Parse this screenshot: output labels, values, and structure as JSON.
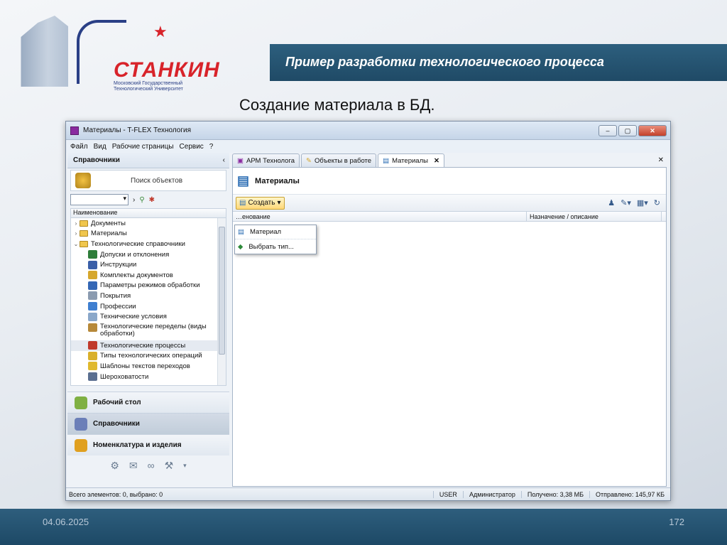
{
  "slide": {
    "banner_title": "Пример разработки технологического процесса",
    "subtitle": "Создание материала в БД.",
    "logo_name": "СТАНКИН",
    "logo_sub": "Московский Государственный Технологический Университет",
    "date": "04.06.2025",
    "page_number": "172"
  },
  "window": {
    "title": "Материалы - T-FLEX Технология",
    "menu": [
      "Файл",
      "Вид",
      "Рабочие страницы",
      "Сервис",
      "?"
    ]
  },
  "left_panel": {
    "header": "Справочники",
    "search_label": "Поиск объектов",
    "tree_column": "Наименование",
    "tree": [
      {
        "label": "Документы",
        "type": "folder",
        "twisty": "›"
      },
      {
        "label": "Материалы",
        "type": "folder",
        "twisty": "›"
      },
      {
        "label": "Технологические справочники",
        "type": "folder",
        "twisty": "⌄"
      },
      {
        "label": "Допуски и отклонения",
        "type": "leaf",
        "color": "#2e7d3a"
      },
      {
        "label": "Инструкции",
        "type": "leaf",
        "color": "#3a5fa8"
      },
      {
        "label": "Комплекты документов",
        "type": "leaf",
        "color": "#d6a72c"
      },
      {
        "label": "Параметры режимов обработки",
        "type": "leaf",
        "color": "#3467b5"
      },
      {
        "label": "Покрытия",
        "type": "leaf",
        "color": "#8b9bb0"
      },
      {
        "label": "Профессии",
        "type": "leaf",
        "color": "#3f7fd0"
      },
      {
        "label": "Технические условия",
        "type": "leaf",
        "color": "#8aa7c9"
      },
      {
        "label": "Технологические переделы (виды обработки)",
        "type": "leaf",
        "color": "#b7893a",
        "tall": true
      },
      {
        "label": "Технологические процессы",
        "type": "leaf",
        "color": "#c0392b",
        "selected": true
      },
      {
        "label": "Типы технологических операций",
        "type": "leaf",
        "color": "#d9b02b"
      },
      {
        "label": "Шаблоны текстов переходов",
        "type": "leaf",
        "color": "#e0b92d"
      },
      {
        "label": "Шероховатости",
        "type": "leaf",
        "color": "#5b6f90"
      }
    ],
    "nav": [
      {
        "label": "Рабочий стол",
        "color": "#7fb043"
      },
      {
        "label": "Справочники",
        "color": "#6b7fb8",
        "active": true
      },
      {
        "label": "Номенклатура и изделия",
        "color": "#e0a020"
      }
    ]
  },
  "right_panel": {
    "tabs": [
      {
        "label": "АРМ Технолога"
      },
      {
        "label": "Объекты в работе"
      },
      {
        "label": "Материалы",
        "active": true
      }
    ],
    "page_title": "Материалы",
    "create_label": "Создать",
    "columns": [
      "…енование",
      "Назначение / описание"
    ],
    "dropdown": [
      "Материал",
      "Выбрать тип..."
    ]
  },
  "status": {
    "left": "Всего элементов: 0, выбрано: 0",
    "user": "USER",
    "role": "Администратор",
    "received": "Получено: 3,38 МБ",
    "sent": "Отправлено: 145,97 КБ"
  }
}
